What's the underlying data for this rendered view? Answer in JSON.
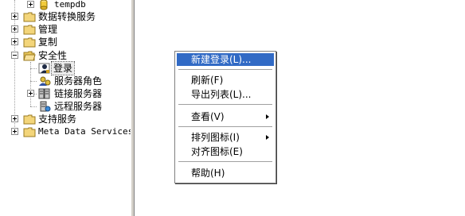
{
  "tree": {
    "items": [
      {
        "label": "tempdb",
        "icon": "database-icon"
      },
      {
        "label": "数据转换服务",
        "icon": "folder-icon"
      },
      {
        "label": "管理",
        "icon": "folder-icon"
      },
      {
        "label": "复制",
        "icon": "folder-icon"
      },
      {
        "label": "安全性",
        "icon": "folder-open-icon"
      },
      {
        "label": "登录",
        "icon": "login-user-icon"
      },
      {
        "label": "服务器角色",
        "icon": "server-role-icon"
      },
      {
        "label": "链接服务器",
        "icon": "linked-server-icon"
      },
      {
        "label": "远程服务器",
        "icon": "remote-server-icon"
      },
      {
        "label": "支持服务",
        "icon": "folder-icon"
      },
      {
        "label": "Meta Data Services",
        "icon": "folder-icon"
      }
    ]
  },
  "context_menu": {
    "items": [
      {
        "label": "新建登录(L)...",
        "highlighted": true
      },
      {
        "label": "刷新(F)"
      },
      {
        "label": "导出列表(L)..."
      },
      {
        "label": "查看(V)",
        "submenu": true
      },
      {
        "label": "排列图标(I)",
        "submenu": true
      },
      {
        "label": "对齐图标(E)"
      },
      {
        "label": "帮助(H)"
      }
    ]
  },
  "colors": {
    "highlight": "#316ac5",
    "folder": "#f3d57a",
    "splitter": "#d4d0c8"
  }
}
